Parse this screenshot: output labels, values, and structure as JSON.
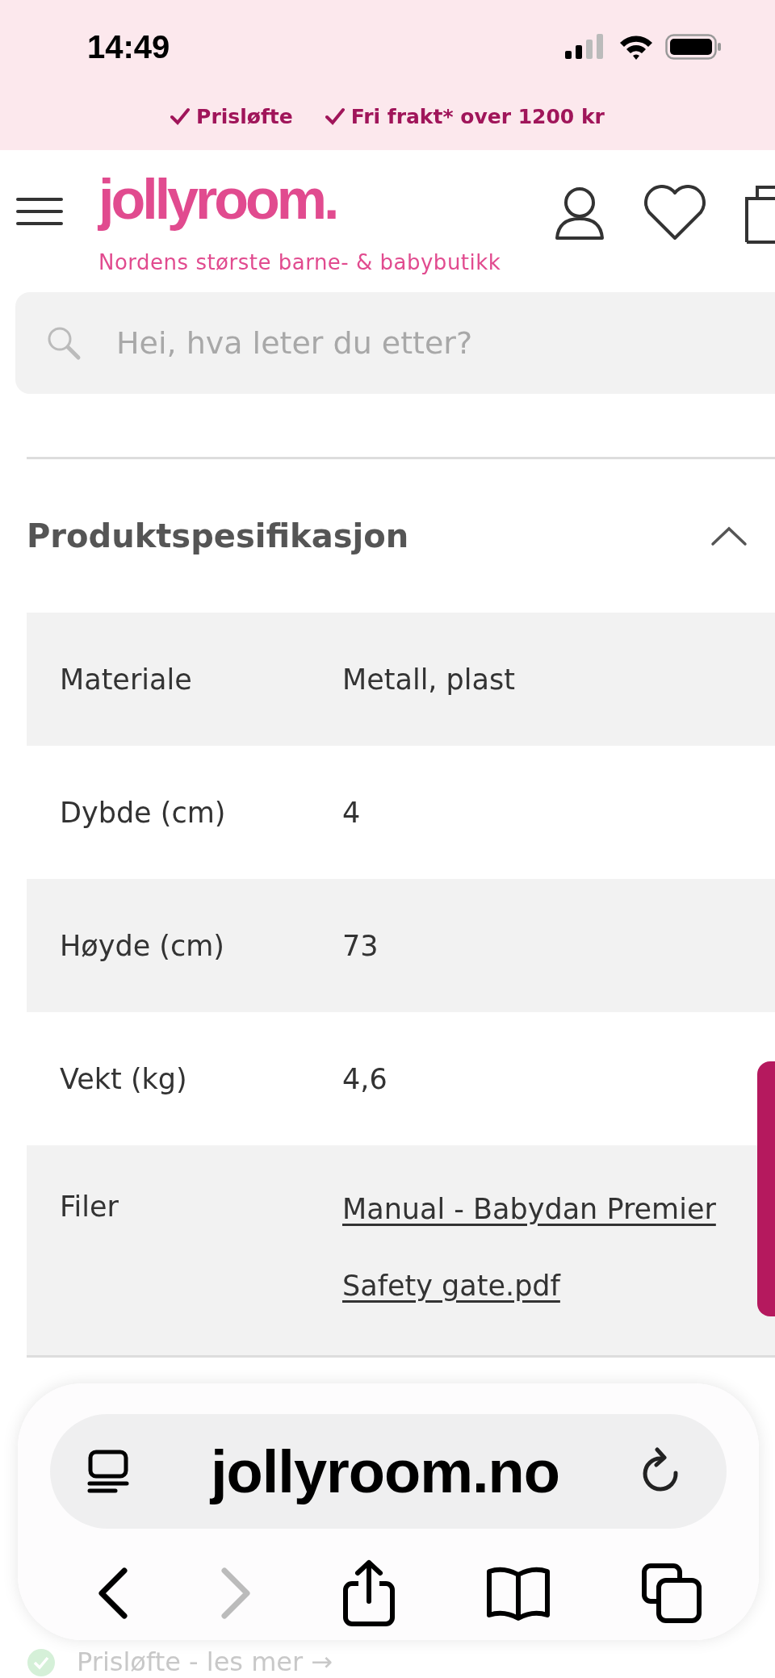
{
  "status_bar": {
    "time": "14:49"
  },
  "promo_bar": {
    "items": [
      "Prisløfte",
      "Fri frakt* over 1200 kr"
    ]
  },
  "header": {
    "logo": "jollyroom.",
    "tagline": "Nordens største barne- & babybutikk"
  },
  "search": {
    "placeholder": "Hei, hva leter du etter?"
  },
  "section": {
    "title": "Produktspesifikasjon",
    "expanded": true
  },
  "specs": [
    {
      "label": "Materiale",
      "value": "Metall, plast",
      "kind": "text"
    },
    {
      "label": "Dybde (cm)",
      "value": "4",
      "kind": "text"
    },
    {
      "label": "Høyde (cm)",
      "value": "73",
      "kind": "text"
    },
    {
      "label": "Vekt (kg)",
      "value": "4,6",
      "kind": "text"
    },
    {
      "label": "Filer",
      "value": "Manual - Babydan Premier Safety gate.pdf",
      "kind": "link"
    }
  ],
  "usp_below": "Prisløfte - les mer →",
  "browser": {
    "url": "jollyroom.no",
    "back_disabled": false,
    "forward_disabled": true
  }
}
